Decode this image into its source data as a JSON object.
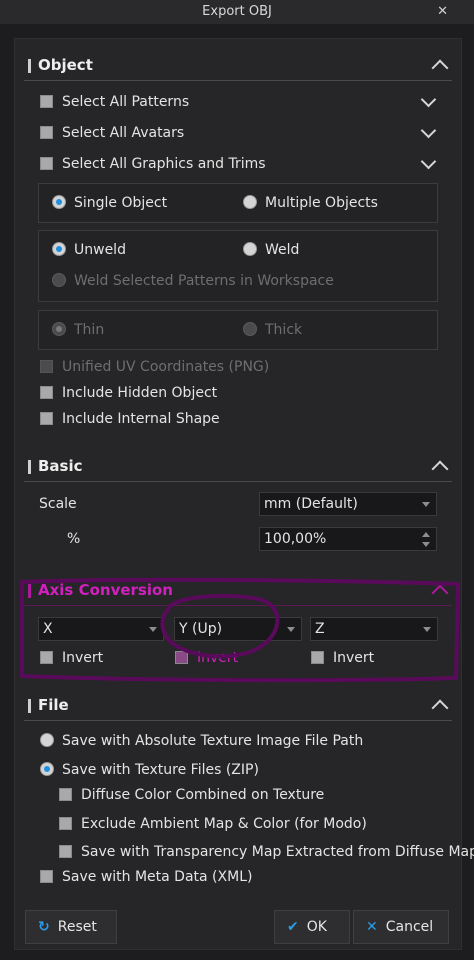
{
  "window": {
    "title": "Export OBJ",
    "close_glyph": "✕"
  },
  "object": {
    "title": "Object",
    "select_patterns": "Select All Patterns",
    "select_avatars": "Select All Avatars",
    "select_graphics": "Select All Graphics and Trims",
    "single_object": "Single Object",
    "multiple_objects": "Multiple Objects",
    "unweld": "Unweld",
    "weld": "Weld",
    "weld_selected": "Weld Selected Patterns in Workspace",
    "thin": "Thin",
    "thick": "Thick",
    "unified_uv": "Unified UV Coordinates (PNG)",
    "include_hidden": "Include Hidden Object",
    "include_internal": "Include Internal Shape"
  },
  "basic": {
    "title": "Basic",
    "scale_label": "Scale",
    "scale_value": "mm (Default)",
    "percent_label": "%",
    "percent_value": "100,00%"
  },
  "axis": {
    "title": "Axis Conversion",
    "x_value": "X",
    "y_value": "Y (Up)",
    "z_value": "Z",
    "invert_label": "Invert"
  },
  "file": {
    "title": "File",
    "save_absolute": "Save with Absolute Texture Image File Path",
    "save_texture_zip": "Save with Texture Files (ZIP)",
    "diffuse_combined": "Diffuse Color Combined on Texture",
    "exclude_ambient": "Exclude Ambient Map & Color (for Modo)",
    "save_transparency": "Save with Transparency Map Extracted from Diffuse Map",
    "save_meta": "Save with Meta Data (XML)"
  },
  "buttons": {
    "reset": "Reset",
    "ok": "OK",
    "cancel": "Cancel",
    "reset_icon": "↻",
    "ok_icon": "✔",
    "cancel_icon": "✕"
  },
  "colors": {
    "accent": "#1f8fe0",
    "annotation": "#5a0a5a",
    "axis_title": "#d21fbf"
  }
}
